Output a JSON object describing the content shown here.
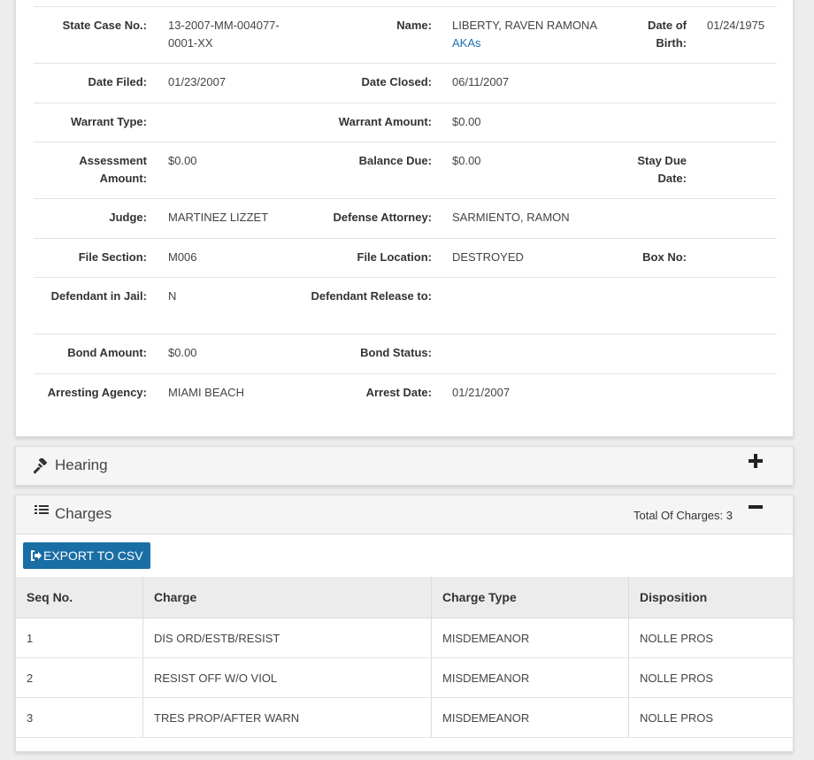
{
  "case": {
    "state_case_no_label": "State Case No.:",
    "state_case_no": "13-2007-MM-004077-0001-XX",
    "name_label": "Name:",
    "name": "LIBERTY, RAVEN RAMONA",
    "akas_link": "AKAs",
    "dob_label": "Date of Birth:",
    "dob": "01/24/1975",
    "date_filed_label": "Date Filed:",
    "date_filed": "01/23/2007",
    "date_closed_label": "Date Closed:",
    "date_closed": "06/11/2007",
    "warrant_type_label": "Warrant Type:",
    "warrant_type": "",
    "warrant_amount_label": "Warrant Amount:",
    "warrant_amount": "$0.00",
    "assessment_amount_label": "Assessment Amount:",
    "assessment_amount": "$0.00",
    "balance_due_label": "Balance Due:",
    "balance_due": "$0.00",
    "stay_due_date_label": "Stay Due Date:",
    "stay_due_date": "",
    "judge_label": "Judge:",
    "judge": "MARTINEZ LIZZET",
    "defense_attorney_label": "Defense Attorney:",
    "defense_attorney": "SARMIENTO, RAMON",
    "file_section_label": "File Section:",
    "file_section": "M006",
    "file_location_label": "File Location:",
    "file_location": "DESTROYED",
    "box_no_label": "Box No:",
    "box_no": "",
    "defendant_in_jail_label": "Defendant in Jail:",
    "defendant_in_jail": "N",
    "defendant_release_label": "Defendant Release to:",
    "defendant_release": "",
    "bond_amount_label": "Bond Amount:",
    "bond_amount": "$0.00",
    "bond_status_label": "Bond Status:",
    "bond_status": "",
    "arresting_agency_label": "Arresting Agency:",
    "arresting_agency": "MIAMI BEACH",
    "arrest_date_label": "Arrest Date:",
    "arrest_date": "01/21/2007"
  },
  "hearing": {
    "title": "Hearing",
    "icon": "gavel-icon",
    "expand_icon": "plus-icon"
  },
  "charges": {
    "title": "Charges",
    "icon": "list-icon",
    "collapse_icon": "minus-icon",
    "total_label": "Total Of Charges:",
    "total": "3",
    "export_label": "EXPORT TO CSV",
    "export_icon": "sign-out-icon",
    "columns": [
      "Seq No.",
      "Charge",
      "Charge Type",
      "Disposition"
    ],
    "rows": [
      {
        "seq": "1",
        "charge": "DIS ORD/ESTB/RESIST",
        "type": "MISDEMEANOR",
        "disposition": "NOLLE PROS"
      },
      {
        "seq": "2",
        "charge": "RESIST OFF W/O VIOL",
        "type": "MISDEMEANOR",
        "disposition": "NOLLE PROS"
      },
      {
        "seq": "3",
        "charge": "TRES PROP/AFTER WARN",
        "type": "MISDEMEANOR",
        "disposition": "NOLLE PROS"
      }
    ]
  },
  "colors": {
    "accent": "#1a6ea6",
    "link": "#1f6fb2",
    "header_bg": "#f5f5f5",
    "page_bg": "#ededed"
  }
}
